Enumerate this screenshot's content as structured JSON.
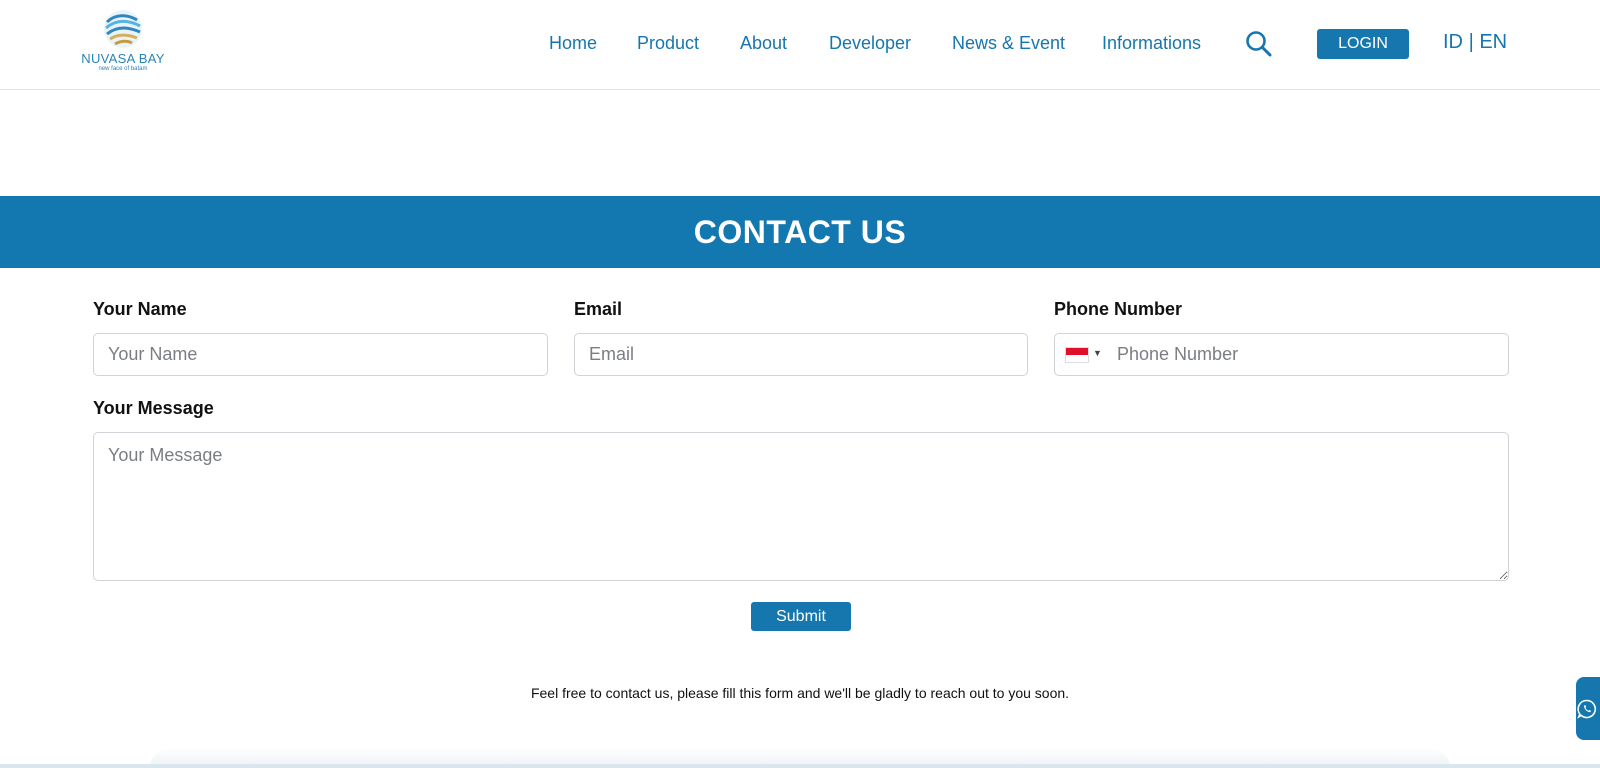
{
  "brand": {
    "name": "NUVASA BAY",
    "tagline": "new face of batam"
  },
  "nav": {
    "items": [
      "Home",
      "Product",
      "About",
      "Developer",
      "News & Event",
      "Informations"
    ],
    "login_label": "LOGIN",
    "lang_id": "ID",
    "lang_separator": "|",
    "lang_en": "EN"
  },
  "banner": {
    "title": "CONTACT US"
  },
  "form": {
    "name_label": "Your Name",
    "name_placeholder": "Your Name",
    "email_label": "Email",
    "email_placeholder": "Email",
    "phone_label": "Phone Number",
    "phone_placeholder": "Phone Number",
    "phone_country_flag": "flag-id-icon",
    "message_label": "Your Message",
    "message_placeholder": "Your Message",
    "submit_label": "Submit"
  },
  "note": "Feel free to contact us, please fill this form and we'll be gladly to reach out to you soon.",
  "icons": {
    "search": "search-icon",
    "whatsapp": "whatsapp-icon"
  },
  "colors": {
    "primary": "#1478b0",
    "nav_text": "#1676ad",
    "text": "#111111"
  }
}
